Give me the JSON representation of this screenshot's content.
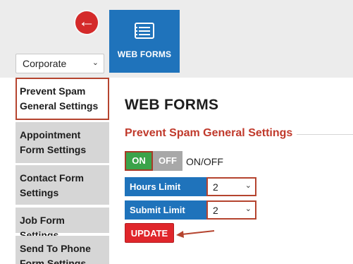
{
  "header": {
    "back_icon": "arrow-left-circle-icon",
    "tile": {
      "icon": "form-list-icon",
      "label": "WEB FORMS"
    },
    "location_select": {
      "value": "Corporate"
    }
  },
  "sidebar": {
    "items": [
      {
        "label": "Prevent Spam General Settings",
        "active": true
      },
      {
        "label": "Appointment Form Settings"
      },
      {
        "label": "Contact Form Settings"
      },
      {
        "label": "Job Form Settings"
      },
      {
        "label": "Send To Phone Form Settings"
      }
    ]
  },
  "main": {
    "title": "WEB FORMS",
    "section_title": "Prevent Spam General Settings",
    "toggle": {
      "on_label": "ON",
      "off_label": "OFF",
      "caption": "ON/OFF",
      "state": "on"
    },
    "fields": [
      {
        "label": "Hours Limit",
        "value": "2"
      },
      {
        "label": "Submit Limit",
        "value": "2"
      }
    ],
    "update_label": "UPDATE"
  },
  "colors": {
    "accent_blue": "#1f73bb",
    "accent_red": "#c0392b",
    "toggle_on": "#3ba34a",
    "highlight_outline": "#b5442f"
  }
}
